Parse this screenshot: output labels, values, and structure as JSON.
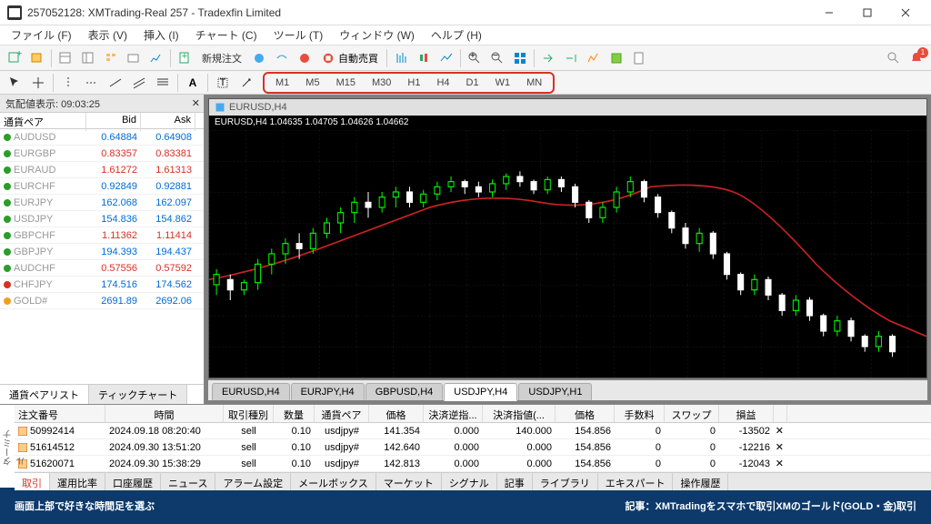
{
  "window": {
    "title": "257052128: XMTrading-Real 257 - Tradexfin Limited"
  },
  "menu": {
    "file": "ファイル (F)",
    "view": "表示 (V)",
    "insert": "挿入 (I)",
    "chart": "チャート (C)",
    "tools": "ツール (T)",
    "window": "ウィンドウ (W)",
    "help": "ヘルプ (H)"
  },
  "toolbar": {
    "new_order": "新規注文",
    "auto_trading": "自動売買"
  },
  "timeframes": [
    "M1",
    "M5",
    "M15",
    "M30",
    "H1",
    "H4",
    "D1",
    "W1",
    "MN"
  ],
  "market_watch": {
    "title": "気配値表示: 09:03:25",
    "cols": {
      "symbol": "通貨ペア",
      "bid": "Bid",
      "ask": "Ask"
    },
    "rows": [
      {
        "sym": "AUDUSD",
        "bid": "0.64884",
        "ask": "0.64908",
        "dir": "up",
        "c": "up"
      },
      {
        "sym": "EURGBP",
        "bid": "0.83357",
        "ask": "0.83381",
        "dir": "up",
        "c": "down"
      },
      {
        "sym": "EURAUD",
        "bid": "1.61272",
        "ask": "1.61313",
        "dir": "up",
        "c": "down"
      },
      {
        "sym": "EURCHF",
        "bid": "0.92849",
        "ask": "0.92881",
        "dir": "up",
        "c": "up"
      },
      {
        "sym": "EURJPY",
        "bid": "162.068",
        "ask": "162.097",
        "dir": "up",
        "c": "up"
      },
      {
        "sym": "USDJPY",
        "bid": "154.836",
        "ask": "154.862",
        "dir": "up",
        "c": "up"
      },
      {
        "sym": "GBPCHF",
        "bid": "1.11362",
        "ask": "1.11414",
        "dir": "up",
        "c": "down"
      },
      {
        "sym": "GBPJPY",
        "bid": "194.393",
        "ask": "194.437",
        "dir": "up",
        "c": "up"
      },
      {
        "sym": "AUDCHF",
        "bid": "0.57556",
        "ask": "0.57592",
        "dir": "up",
        "c": "down"
      },
      {
        "sym": "CHFJPY",
        "bid": "174.516",
        "ask": "174.562",
        "dir": "down",
        "c": "up"
      },
      {
        "sym": "GOLD#",
        "bid": "2691.89",
        "ask": "2692.06",
        "dir": "gold",
        "c": "up"
      }
    ],
    "tabs": {
      "pairs": "通貨ペアリスト",
      "tick": "ティックチャート"
    }
  },
  "chart": {
    "window_title": "EURUSD,H4",
    "ohlc": "EURUSD,H4  1.04635 1.04705 1.04626 1.04662",
    "tabs": [
      "EURUSD,H4",
      "EURJPY,H4",
      "GBPUSD,H4",
      "USDJPY,H4",
      "USDJPY,H1"
    ],
    "active_tab": 3
  },
  "orders": {
    "cols": {
      "number": "注文番号",
      "time": "時間",
      "type": "取引種別",
      "vol": "数量",
      "pair": "通貨ペア",
      "price": "価格",
      "sl": "決済逆指...",
      "tp": "決済指値(...",
      "price2": "価格",
      "comm": "手数料",
      "swap": "スワップ",
      "profit": "損益"
    },
    "rows": [
      {
        "num": "50992414",
        "time": "2024.09.18 08:20:40",
        "type": "sell",
        "vol": "0.10",
        "pair": "usdjpy#",
        "p1": "141.354",
        "sl": "0.000",
        "tp": "140.000",
        "p2": "154.856",
        "comm": "0",
        "swap": "0",
        "profit": "-13502"
      },
      {
        "num": "51614512",
        "time": "2024.09.30 13:51:20",
        "type": "sell",
        "vol": "0.10",
        "pair": "usdjpy#",
        "p1": "142.640",
        "sl": "0.000",
        "tp": "0.000",
        "p2": "154.856",
        "comm": "0",
        "swap": "0",
        "profit": "-12216"
      },
      {
        "num": "51620071",
        "time": "2024.09.30 15:38:29",
        "type": "sell",
        "vol": "0.10",
        "pair": "usdjpy#",
        "p1": "142.813",
        "sl": "0.000",
        "tp": "0.000",
        "p2": "154.856",
        "comm": "0",
        "swap": "0",
        "profit": "-12043"
      }
    ],
    "tabs": [
      "取引",
      "運用比率",
      "口座履歴",
      "ニュース",
      "アラーム設定",
      "メールボックス",
      "マーケット",
      "シグナル",
      "記事",
      "ライブラリ",
      "エキスパート",
      "操作履歴"
    ],
    "vlabel": "ターミナル"
  },
  "caption": {
    "left": "画面上部で好きな時間足を選ぶ",
    "right": "記事：XMTradingをスマホで取引XMのゴールド(GOLD・金)取引"
  }
}
